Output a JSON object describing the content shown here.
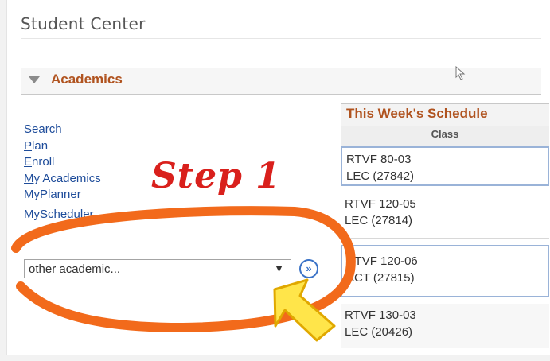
{
  "page": {
    "title": "Student Center"
  },
  "academics": {
    "title": "Academics",
    "links": [
      {
        "label": "Search",
        "underline": "S",
        "rest": "earch"
      },
      {
        "label": "Plan",
        "underline": "P",
        "rest": "lan"
      },
      {
        "label": "Enroll",
        "underline": "E",
        "rest": "nroll"
      },
      {
        "label": "My Academics",
        "underline": "M",
        "rest": "y Academics"
      },
      {
        "label": "MyPlanner",
        "underline": "",
        "rest": "MyPlanner"
      },
      {
        "label": "MyScheduler",
        "underline": "",
        "rest": "MyScheduler"
      }
    ],
    "select": {
      "value": "other academic...",
      "arrow": "▼"
    },
    "go_glyph": "»"
  },
  "annotation": {
    "step": "Step 1"
  },
  "schedule": {
    "title": "This Week's Schedule",
    "column": "Class",
    "rows": [
      {
        "line1": "RTVF 80-03",
        "line2": "LEC (27842)"
      },
      {
        "line1": "RTVF 120-05",
        "line2": "LEC (27814)"
      },
      {
        "line1": "RTVF 120-06",
        "line2": "ACT (27815)"
      },
      {
        "line1": "RTVF 130-03",
        "line2": "LEC (20426)"
      }
    ]
  },
  "colors": {
    "section_title": "#b0531f",
    "link": "#1e4c9a",
    "annotation": "#d9201c",
    "ring": "#f26a1b",
    "arrow_fill": "#ffe54a",
    "arrow_stroke": "#e0a800"
  }
}
